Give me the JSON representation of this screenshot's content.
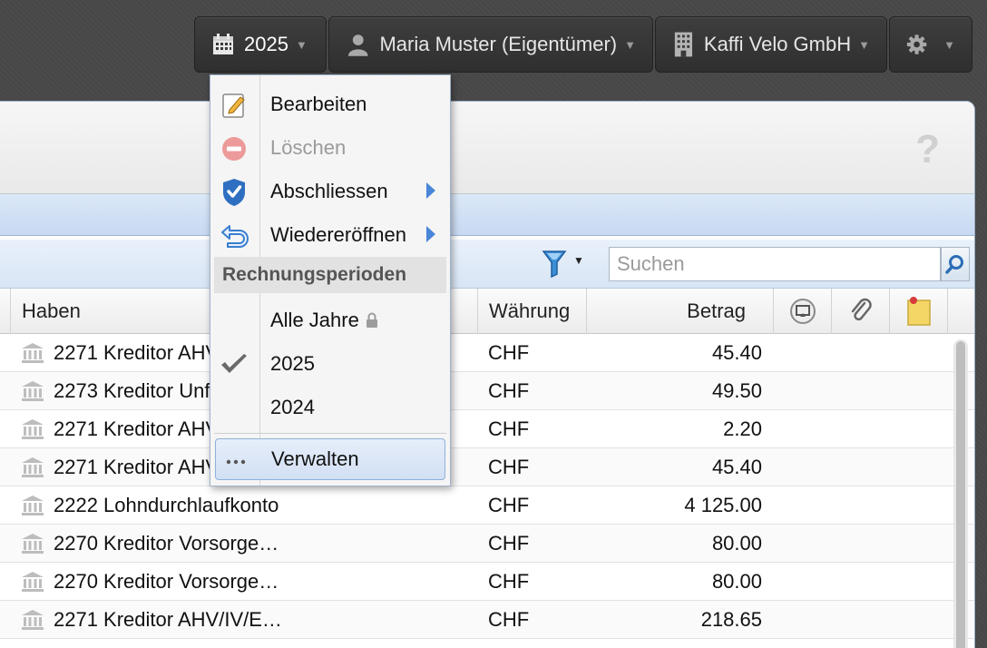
{
  "topnav": {
    "year": "2025",
    "user": "Maria Muster (Eigentümer)",
    "company": "Kaffi Velo GmbH",
    "icons": {
      "year": "calendar-icon",
      "user": "person-icon",
      "company": "building-icon",
      "settings": "gear-icon"
    }
  },
  "menu": {
    "items": [
      {
        "label": "Bearbeiten",
        "icon": "edit-pencil-icon",
        "enabled": true
      },
      {
        "label": "Löschen",
        "icon": "delete-minus-icon",
        "enabled": false
      },
      {
        "label": "Abschliessen",
        "icon": "shield-check-icon",
        "enabled": true,
        "submenu": true
      },
      {
        "label": "Wiedereröffnen",
        "icon": "undo-arrow-icon",
        "enabled": true,
        "submenu": true
      }
    ],
    "section_title": "Rechnungsperioden",
    "periods": [
      {
        "label": "Alle Jahre",
        "icon": "lock-icon",
        "checked": false
      },
      {
        "label": "2025",
        "checked": true
      },
      {
        "label": "2024",
        "checked": false
      }
    ],
    "manage": {
      "label": "Verwalten",
      "icon": "ellipsis-icon"
    }
  },
  "toolbar": {
    "search_placeholder": "Suchen"
  },
  "table": {
    "columns": {
      "haben": "Haben",
      "waehrung": "Währung",
      "betrag": "Betrag"
    },
    "rows": [
      {
        "haben": "2271 Kreditor AHV",
        "currency": "CHF",
        "amount": "45.40"
      },
      {
        "haben": "2273 Kreditor Unf",
        "currency": "CHF",
        "amount": "49.50"
      },
      {
        "haben": "2271 Kreditor AHV",
        "currency": "CHF",
        "amount": "2.20"
      },
      {
        "haben": "2271 Kreditor AHV",
        "currency": "CHF",
        "amount": "45.40"
      },
      {
        "haben": "2222 Lohndurchlaufkonto",
        "currency": "CHF",
        "amount": "4 125.00"
      },
      {
        "haben": "2270 Kreditor Vorsorge…",
        "currency": "CHF",
        "amount": "80.00"
      },
      {
        "haben": "2270 Kreditor Vorsorge…",
        "currency": "CHF",
        "amount": "80.00"
      },
      {
        "haben": "2271 Kreditor AHV/IV/E…",
        "currency": "CHF",
        "amount": "218.65"
      }
    ]
  },
  "help": "?",
  "colors": {
    "accent": "#4a86d8",
    "menu_highlight": "#d2e0f4",
    "header_band": "#c7d9f1"
  }
}
